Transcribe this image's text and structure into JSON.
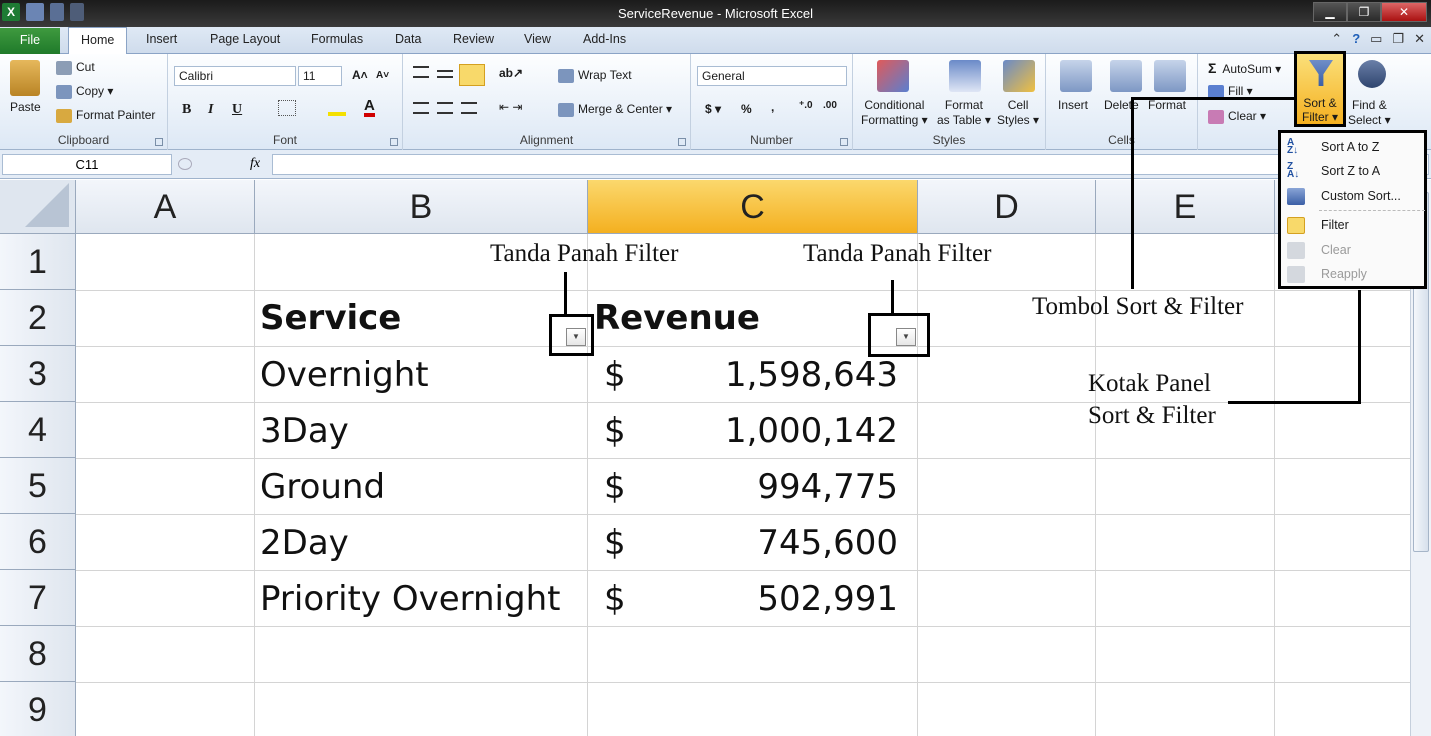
{
  "window": {
    "title": "ServiceRevenue - Microsoft Excel",
    "minimize": "▁",
    "restore": "❐",
    "close": "✕"
  },
  "tabs": {
    "file": "File",
    "items": [
      "Home",
      "Insert",
      "Page Layout",
      "Formulas",
      "Data",
      "Review",
      "View",
      "Add-Ins"
    ],
    "active": "Home"
  },
  "ribbon": {
    "clipboard": {
      "paste": "Paste",
      "cut": "Cut",
      "copy": "Copy ▾",
      "format_painter": "Format Painter",
      "label": "Clipboard"
    },
    "font": {
      "family": "Calibri",
      "size": "11",
      "bold": "B",
      "italic": "I",
      "underline": "U",
      "grow": "A˄",
      "shrink": "A˅",
      "label": "Font"
    },
    "alignment": {
      "wrap": "Wrap Text",
      "merge": "Merge & Center ▾",
      "label": "Alignment"
    },
    "number": {
      "format": "General",
      "currency": "$ ▾",
      "percent": "%",
      "comma": ",",
      "inc": "⁺.0",
      "dec": ".00",
      "label": "Number"
    },
    "styles": {
      "conditional": [
        "Conditional",
        "Formatting ▾"
      ],
      "table": [
        "Format",
        "as Table ▾"
      ],
      "cell": [
        "Cell",
        "Styles ▾"
      ],
      "label": "Styles"
    },
    "cells": {
      "insert": "Insert",
      "delete": "Delete",
      "format": "Format",
      "label": "Cells"
    },
    "editing": {
      "autosum": "AutoSum ▾",
      "fill": "Fill ▾",
      "clear": "Clear ▾",
      "sort": [
        "Sort &",
        "Filter ▾"
      ],
      "find": [
        "Find &",
        "Select ▾"
      ]
    }
  },
  "formula_bar": {
    "name_box": "C11",
    "fx": "fx",
    "content": ""
  },
  "columns": [
    "A",
    "B",
    "C",
    "D",
    "E"
  ],
  "rows": [
    "1",
    "2",
    "3",
    "4",
    "5",
    "6",
    "7",
    "8",
    "9"
  ],
  "sheet": {
    "headers": {
      "service": "Service",
      "revenue": "Revenue"
    },
    "data": [
      {
        "service": "Overnight",
        "currency": "$",
        "revenue": "1,598,643"
      },
      {
        "service": "3Day",
        "currency": "$",
        "revenue": "1,000,142"
      },
      {
        "service": "Ground",
        "currency": "$",
        "revenue": "994,775"
      },
      {
        "service": "2Day",
        "currency": "$",
        "revenue": "745,600"
      },
      {
        "service": "Priority Overnight",
        "currency": "$",
        "revenue": "502,991"
      }
    ]
  },
  "sort_menu": {
    "items": [
      {
        "label": "Sort A to Z",
        "enabled": true
      },
      {
        "label": "Sort Z to A",
        "enabled": true
      },
      {
        "label": "Custom Sort...",
        "enabled": true
      },
      {
        "label": "Filter",
        "enabled": true
      },
      {
        "label": "Clear",
        "enabled": false
      },
      {
        "label": "Reapply",
        "enabled": false
      }
    ]
  },
  "annotations": {
    "filter_arrow_1": "Tanda Panah Filter",
    "filter_arrow_2": "Tanda Panah Filter",
    "sort_button": "Tombol Sort & Filter",
    "panel_line1": "Kotak Panel",
    "panel_line2": "Sort & Filter"
  },
  "colors": {
    "accent": "#f4b020",
    "file_tab": "#2a842f",
    "ribbon_bg": "#dde8f5"
  }
}
